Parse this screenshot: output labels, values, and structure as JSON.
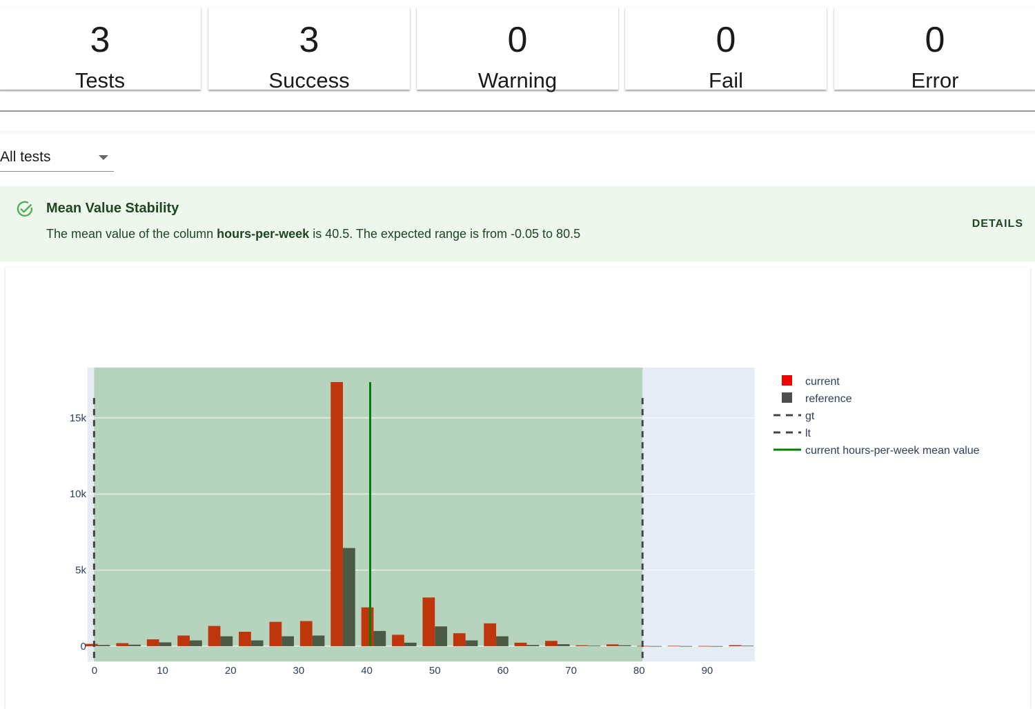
{
  "summary": [
    {
      "count": "3",
      "label": "Tests"
    },
    {
      "count": "3",
      "label": "Success"
    },
    {
      "count": "0",
      "label": "Warning"
    },
    {
      "count": "0",
      "label": "Fail"
    },
    {
      "count": "0",
      "label": "Error"
    }
  ],
  "filter": {
    "selected": "All tests"
  },
  "test": {
    "title": "Mean Value Stability",
    "message_prefix": "The mean value of the column ",
    "column": "hours-per-week",
    "message_suffix": " is 40.5. The expected range is from -0.05 to 80.5",
    "details_label": "DETAILS",
    "status_color": "#4caf50"
  },
  "chart_data": {
    "type": "bar",
    "xticks": [
      "0",
      "10",
      "20",
      "30",
      "40",
      "50",
      "60",
      "70",
      "80",
      "90"
    ],
    "yticks": [
      "0",
      "5k",
      "10k",
      "15k"
    ],
    "xlim": [
      -1,
      97
    ],
    "ylim": [
      -1000,
      18300
    ],
    "bin_centers": [
      0.5,
      5,
      9.5,
      14,
      18.5,
      23,
      27.5,
      32,
      36.5,
      41,
      45.5,
      50,
      54.5,
      59,
      63.5,
      68,
      72.5,
      77,
      81.5,
      86,
      90.5,
      95
    ],
    "series": [
      {
        "name": "current",
        "color": "#bf360c",
        "values": [
          150,
          200,
          450,
          700,
          1330,
          950,
          1600,
          1650,
          17350,
          2550,
          750,
          3200,
          850,
          1500,
          230,
          350,
          60,
          120,
          20,
          25,
          15,
          70
        ]
      },
      {
        "name": "reference",
        "color": "#4a5a44",
        "values": [
          80,
          100,
          250,
          380,
          650,
          380,
          650,
          700,
          6450,
          1000,
          230,
          1300,
          380,
          650,
          80,
          130,
          30,
          60,
          10,
          10,
          8,
          30
        ]
      }
    ],
    "lines": [
      {
        "name": "gt",
        "x": -0.05,
        "style": "dash",
        "color": "#444444"
      },
      {
        "name": "lt",
        "x": 80.5,
        "style": "dash",
        "color": "#444444"
      },
      {
        "name": "current hours-per-week mean value",
        "x": 40.5,
        "style": "solid",
        "color": "#008000"
      }
    ],
    "shaded_range": [
      -0.05,
      80.5
    ],
    "legend_colors": {
      "current": "#ed0400",
      "reference": "#4d4d4d"
    },
    "legend_position": "right"
  }
}
